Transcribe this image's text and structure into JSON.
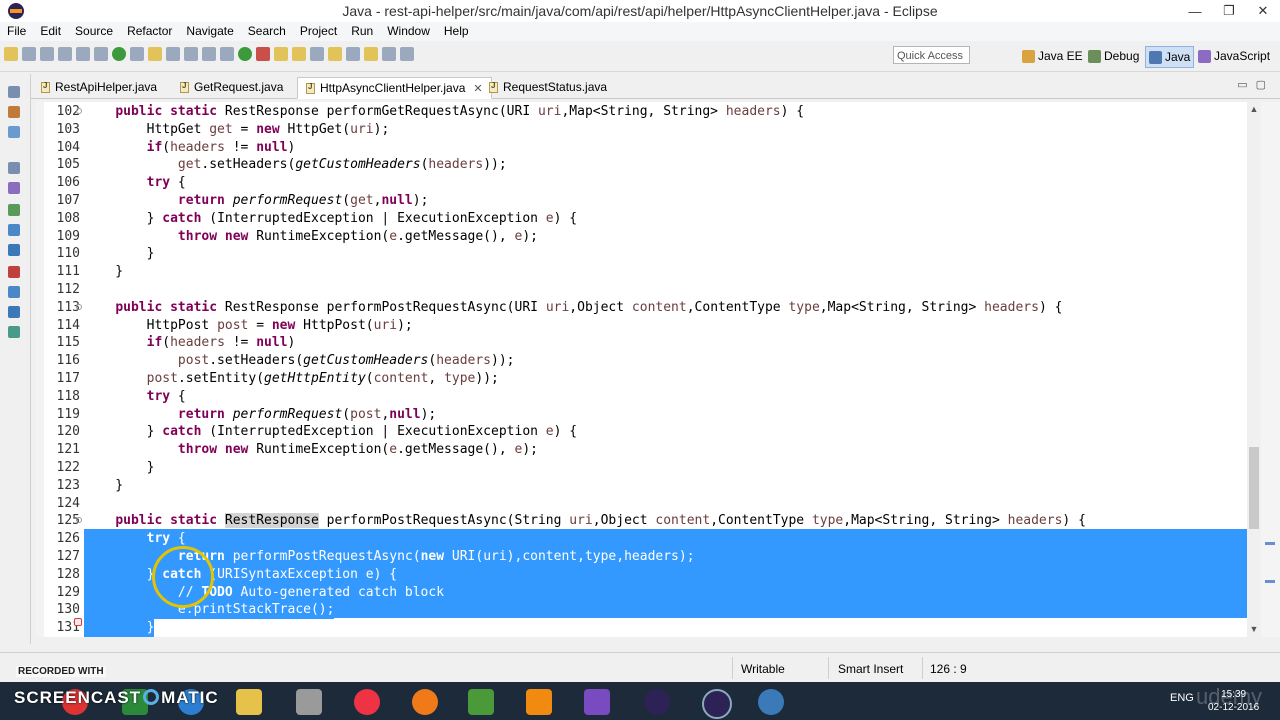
{
  "window": {
    "title": "Java - rest-api-helper/src/main/java/com/api/rest/api/helper/HttpAsyncClientHelper.java - Eclipse",
    "controls": [
      "—",
      "❐",
      "✕"
    ]
  },
  "menu": [
    "File",
    "Edit",
    "Source",
    "Refactor",
    "Navigate",
    "Search",
    "Project",
    "Run",
    "Window",
    "Help"
  ],
  "quick_access": "Quick Access",
  "perspectives": [
    {
      "label": "Java EE",
      "active": false
    },
    {
      "label": "Debug",
      "active": false
    },
    {
      "label": "Java",
      "active": true
    },
    {
      "label": "JavaScript",
      "active": false
    }
  ],
  "tabs": [
    {
      "label": "RestApiHelper.java",
      "active": false
    },
    {
      "label": "GetRequest.java",
      "active": false
    },
    {
      "label": "HttpAsyncClientHelper.java",
      "active": true,
      "close": "✕"
    },
    {
      "label": "RequestStatus.java",
      "active": false
    }
  ],
  "view_buttons": [
    "▭",
    "▢"
  ],
  "code_lines": [
    {
      "n": "102",
      "fold": true,
      "html": "    <span class=\"kw\">public</span> <span class=\"kw\">static</span> RestResponse performGetRequestAsync(URI <span class=\"par\">uri</span>,Map&lt;String, String&gt; <span class=\"par\">headers</span>) {"
    },
    {
      "n": "103",
      "html": "        HttpGet <span class=\"par\">get</span> = <span class=\"kw\">new</span> HttpGet(<span class=\"par\">uri</span>);"
    },
    {
      "n": "104",
      "html": "        <span class=\"kw\">if</span>(<span class=\"par\">headers</span> != <span class=\"kw\">null</span>)"
    },
    {
      "n": "105",
      "html": "            <span class=\"par\">get</span>.setHeaders(<span class=\"it\">getCustomHeaders</span>(<span class=\"par\">headers</span>));"
    },
    {
      "n": "106",
      "html": "        <span class=\"kw\">try</span> {"
    },
    {
      "n": "107",
      "html": "            <span class=\"kw\">return</span> <span class=\"it\">performRequest</span>(<span class=\"par\">get</span>,<span class=\"kw\">null</span>);"
    },
    {
      "n": "108",
      "html": "        } <span class=\"kw\">catch</span> (InterruptedException | ExecutionException <span class=\"par\">e</span>) {"
    },
    {
      "n": "109",
      "html": "            <span class=\"kw\">throw</span> <span class=\"kw\">new</span> RuntimeException(<span class=\"par\">e</span>.getMessage(), <span class=\"par\">e</span>);"
    },
    {
      "n": "110",
      "html": "        }"
    },
    {
      "n": "111",
      "html": "    }"
    },
    {
      "n": "112",
      "html": ""
    },
    {
      "n": "113",
      "fold": true,
      "html": "    <span class=\"kw\">public</span> <span class=\"kw\">static</span> RestResponse performPostRequestAsync(URI <span class=\"par\">uri</span>,Object <span class=\"par\">content</span>,ContentType <span class=\"par\">type</span>,Map&lt;String, String&gt; <span class=\"par\">headers</span>) {"
    },
    {
      "n": "114",
      "html": "        HttpPost <span class=\"par\">post</span> = <span class=\"kw\">new</span> HttpPost(<span class=\"par\">uri</span>);"
    },
    {
      "n": "115",
      "html": "        <span class=\"kw\">if</span>(<span class=\"par\">headers</span> != <span class=\"kw\">null</span>)"
    },
    {
      "n": "116",
      "html": "            <span class=\"par\">post</span>.setHeaders(<span class=\"it\">getCustomHeaders</span>(<span class=\"par\">headers</span>));"
    },
    {
      "n": "117",
      "html": "        <span class=\"par\">post</span>.setEntity(<span class=\"it\">getHttpEntity</span>(<span class=\"par\">content</span>, <span class=\"par\">type</span>));"
    },
    {
      "n": "118",
      "html": "        <span class=\"kw\">try</span> {"
    },
    {
      "n": "119",
      "html": "            <span class=\"kw\">return</span> <span class=\"it\">performRequest</span>(<span class=\"par\">post</span>,<span class=\"kw\">null</span>);"
    },
    {
      "n": "120",
      "html": "        } <span class=\"kw\">catch</span> (InterruptedException | ExecutionException <span class=\"par\">e</span>) {"
    },
    {
      "n": "121",
      "html": "            <span class=\"kw\">throw</span> <span class=\"kw\">new</span> RuntimeException(<span class=\"par\">e</span>.getMessage(), <span class=\"par\">e</span>);"
    },
    {
      "n": "122",
      "html": "        }"
    },
    {
      "n": "123",
      "html": "    }"
    },
    {
      "n": "124",
      "html": ""
    },
    {
      "n": "125",
      "fold": true,
      "html": "    <span class=\"kw\">public</span> <span class=\"kw\">static</span> <span class=\"hl\">RestResponse</span> performPostRequestAsync(String <span class=\"par\">uri</span>,Object <span class=\"par\">content</span>,ContentType <span class=\"par\">type</span>,Map&lt;String, String&gt; <span class=\"par\">headers</span>) {"
    },
    {
      "n": "126",
      "sel": true,
      "html": "        <span class=\"kw\">try</span> {"
    },
    {
      "n": "127",
      "sel": true,
      "html": "            <span class=\"kw\">return</span> performPostRequestAsync(<span class=\"kw\">new</span> URI(<span class=\"par\">uri</span>),<span class=\"par\">content</span>,<span class=\"par\">type</span>,<span class=\"par\">headers</span>);"
    },
    {
      "n": "128",
      "sel": true,
      "html": "        } <span class=\"kw\">catch</span> (URISyntaxException <span class=\"par\">e</span>) {"
    },
    {
      "n": "129",
      "sel": true,
      "html": "            <span class=\"cm\">// <b>TODO</b> Auto-generated catch block</span>"
    },
    {
      "n": "130",
      "sel": true,
      "html": "            <span class=\"par\">e</span>.printStackTrace();"
    },
    {
      "n": "131",
      "sel": true,
      "html": "        }"
    }
  ],
  "status": {
    "writable": "Writable",
    "insert_mode": "Smart Insert",
    "position": "126 : 9"
  },
  "recorded_with": "RECORDED WITH",
  "brand": {
    "left": "SCREENCAST",
    "right": "MATIC"
  },
  "tray": {
    "lang": "ENG",
    "time": "15:39",
    "date": "02-12-2016"
  },
  "watermark": "udemy"
}
